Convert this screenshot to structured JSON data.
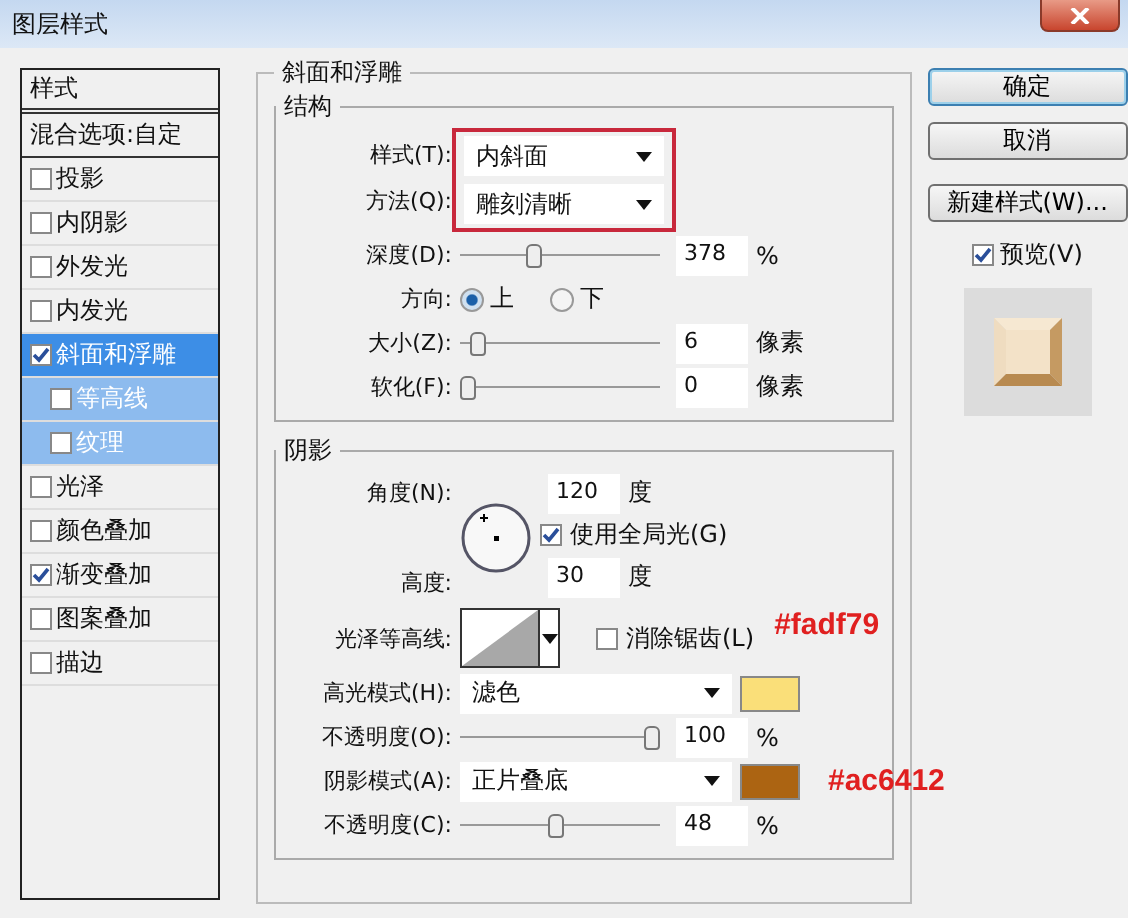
{
  "window": {
    "title": "图层样式"
  },
  "sidebar": {
    "items": [
      {
        "kind": "header",
        "label": "样式"
      },
      {
        "kind": "option",
        "label": "混合选项:自定",
        "selected": false
      },
      {
        "kind": "effect",
        "label": "投影",
        "checked": false,
        "selected": false
      },
      {
        "kind": "effect",
        "label": "内阴影",
        "checked": false,
        "selected": false
      },
      {
        "kind": "effect",
        "label": "外发光",
        "checked": false,
        "selected": false
      },
      {
        "kind": "effect",
        "label": "内发光",
        "checked": false,
        "selected": false
      },
      {
        "kind": "effect",
        "label": "斜面和浮雕",
        "checked": true,
        "selected": true,
        "children": [
          {
            "label": "等高线",
            "checked": false,
            "selected": false
          },
          {
            "label": "纹理",
            "checked": false,
            "selected": false
          }
        ]
      },
      {
        "kind": "effect",
        "label": "光泽",
        "checked": false,
        "selected": false
      },
      {
        "kind": "effect",
        "label": "颜色叠加",
        "checked": false,
        "selected": false
      },
      {
        "kind": "effect",
        "label": "渐变叠加",
        "checked": true,
        "selected": false
      },
      {
        "kind": "effect",
        "label": "图案叠加",
        "checked": false,
        "selected": false
      },
      {
        "kind": "effect",
        "label": "描边",
        "checked": false,
        "selected": false
      }
    ]
  },
  "bevel": {
    "title": "斜面和浮雕",
    "structure": {
      "title": "结构",
      "style": {
        "label": "样式(T):",
        "value": "内斜面"
      },
      "technique": {
        "label": "方法(Q):",
        "value": "雕刻清晰"
      },
      "depth": {
        "label": "深度(D):",
        "level": 0.36,
        "value": "378",
        "unit": "%"
      },
      "direction": {
        "label": "方向:",
        "options": [
          {
            "label": "上",
            "selected": true
          },
          {
            "label": "下",
            "selected": false
          }
        ]
      },
      "size": {
        "label": "大小(Z):",
        "level": 0.05,
        "value": "6",
        "unit": "像素"
      },
      "soften": {
        "label": "软化(F):",
        "level": 0,
        "value": "0",
        "unit": "像素"
      }
    },
    "shading": {
      "title": "阴影",
      "angle": {
        "label": "角度(N):",
        "value": "120",
        "unit": "度"
      },
      "global_light": {
        "label": "使用全局光(G)",
        "checked": true
      },
      "altitude": {
        "label": "高度:",
        "value": "30",
        "unit": "度"
      },
      "gloss_contour": {
        "label": "光泽等高线:"
      },
      "anti_aliased": {
        "label": "消除锯齿(L)",
        "checked": false
      },
      "highlight_mode": {
        "label": "高光模式(H):",
        "value": "滤色",
        "color": "#fadf79"
      },
      "highlight_opacity": {
        "label": "不透明度(O):",
        "level": 1,
        "value": "100",
        "unit": "%"
      },
      "shadow_mode": {
        "label": "阴影模式(A):",
        "value": "正片叠底",
        "color": "#ac6412"
      },
      "shadow_opacity": {
        "label": "不透明度(C):",
        "level": 0.48,
        "value": "48",
        "unit": "%"
      }
    }
  },
  "buttons": [
    {
      "label": "确定",
      "default": true
    },
    {
      "label": "取消",
      "default": false
    },
    {
      "label": "新建样式(W)...",
      "default": false
    }
  ],
  "preview": {
    "label": "预览(V)",
    "checked": true
  },
  "annotations": {
    "highlight_note": "#fadf79",
    "shadow_note": "#ac6412"
  }
}
